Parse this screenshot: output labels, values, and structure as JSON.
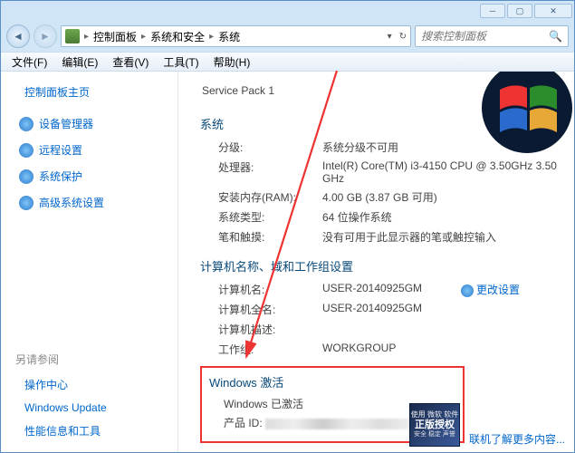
{
  "breadcrumb": {
    "root": "控制面板",
    "l1": "系统和安全",
    "l2": "系统"
  },
  "search": {
    "placeholder": "搜索控制面板"
  },
  "menu": {
    "file": "文件(F)",
    "edit": "编辑(E)",
    "view": "查看(V)",
    "tools": "工具(T)",
    "help": "帮助(H)"
  },
  "sidebar": {
    "home": "控制面板主页",
    "items": [
      {
        "label": "设备管理器"
      },
      {
        "label": "远程设置"
      },
      {
        "label": "系统保护"
      },
      {
        "label": "高级系统设置"
      }
    ],
    "related_title": "另请参阅",
    "related": [
      {
        "label": "操作中心"
      },
      {
        "label": "Windows Update"
      },
      {
        "label": "性能信息和工具"
      }
    ]
  },
  "service_pack": "Service Pack 1",
  "sys_section": "系统",
  "sys": {
    "rating_k": "分级:",
    "rating_v": "系统分级不可用",
    "cpu_k": "处理器:",
    "cpu_v": "Intel(R) Core(TM) i3-4150 CPU @ 3.50GHz  3.50 GHz",
    "ram_k": "安装内存(RAM):",
    "ram_v": "4.00 GB (3.87 GB 可用)",
    "type_k": "系统类型:",
    "type_v": "64 位操作系统",
    "pen_k": "笔和触摸:",
    "pen_v": "没有可用于此显示器的笔或触控输入"
  },
  "net_section": "计算机名称、域和工作组设置",
  "net": {
    "name_k": "计算机名:",
    "name_v": "USER-20140925GM",
    "full_k": "计算机全名:",
    "full_v": "USER-20140925GM",
    "desc_k": "计算机描述:",
    "desc_v": "",
    "wg_k": "工作组:",
    "wg_v": "WORKGROUP",
    "change": "更改设置"
  },
  "act_section": "Windows 激活",
  "act": {
    "status": "Windows 已激活",
    "pid_k": "产品 ID:"
  },
  "badge": {
    "l1": "使用 微软 软件",
    "l2": "正版授权",
    "l3": "安全 稳定 声誉"
  },
  "more_link": "联机了解更多内容..."
}
